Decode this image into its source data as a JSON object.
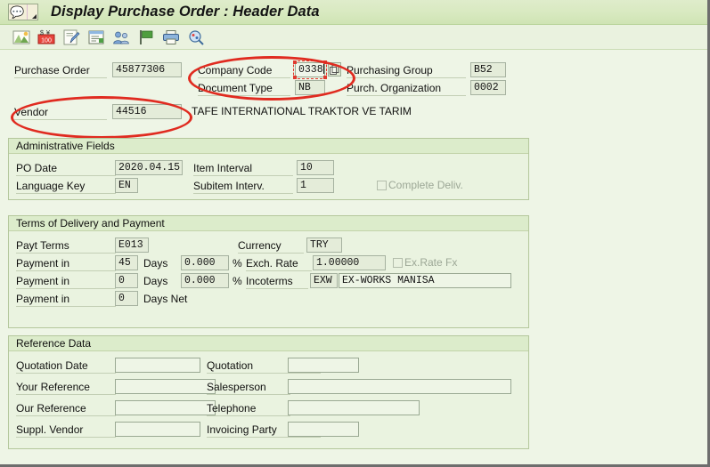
{
  "window": {
    "title": "Display Purchase Order : Header Data",
    "system_menu_icon": "sap-menu-icon"
  },
  "toolbar": {
    "buttons": [
      {
        "name": "overview-icon",
        "label": "Overview"
      },
      {
        "name": "currency-icon",
        "label": "Currency"
      },
      {
        "name": "edit-icon",
        "label": "Display/Change"
      },
      {
        "name": "header-details-icon",
        "label": "Header Details"
      },
      {
        "name": "partners-icon",
        "label": "Partners"
      },
      {
        "name": "flag-icon",
        "label": "Flag"
      },
      {
        "name": "print-icon",
        "label": "Print Preview"
      },
      {
        "name": "find-icon",
        "label": "Find"
      }
    ]
  },
  "header": {
    "purchase_order_label": "Purchase Order",
    "purchase_order_value": "45877306",
    "vendor_label": "Vendor",
    "vendor_value": "44516",
    "vendor_name": "TAFE INTERNATIONAL TRAKTOR VE TARIM",
    "company_code_label": "Company Code",
    "company_code_value": "0338",
    "document_type_label": "Document Type",
    "document_type_value": "NB",
    "purchasing_group_label": "Purchasing Group",
    "purchasing_group_value": "B52",
    "purch_organization_label": "Purch. Organization",
    "purch_organization_value": "0002"
  },
  "administrative": {
    "title": "Administrative Fields",
    "po_date_label": "PO Date",
    "po_date_value": "2020.04.15",
    "language_key_label": "Language Key",
    "language_key_value": "EN",
    "item_interval_label": "Item Interval",
    "item_interval_value": "10",
    "subitem_interval_label": "Subitem Interv.",
    "subitem_interval_value": "1",
    "complete_deliv_label": "Complete Deliv.",
    "complete_deliv_checked": false
  },
  "terms": {
    "title": "Terms of Delivery and Payment",
    "payt_terms_label": "Payt Terms",
    "payt_terms_value": "E013",
    "payment_in_label": "Payment in",
    "days_label": "Days",
    "days_net_label": "Days Net",
    "percent_symbol": "%",
    "payment_rows": [
      {
        "days": "45",
        "percent": "0.000"
      },
      {
        "days": "0",
        "percent": "0.000"
      },
      {
        "days": "0",
        "percent": ""
      }
    ],
    "currency_label": "Currency",
    "currency_value": "TRY",
    "exch_rate_label": "Exch. Rate",
    "exch_rate_value": "1.00000",
    "ex_rate_fx_label": "Ex.Rate Fx",
    "ex_rate_fx_checked": false,
    "incoterms_label": "Incoterms",
    "incoterms_code": "EXW",
    "incoterms_text": "EX-WORKS MANISA"
  },
  "reference": {
    "title": "Reference Data",
    "quotation_date_label": "Quotation Date",
    "quotation_date_value": "",
    "your_reference_label": "Your Reference",
    "your_reference_value": "",
    "our_reference_label": "Our Reference",
    "our_reference_value": "",
    "suppl_vendor_label": "Suppl. Vendor",
    "suppl_vendor_value": "",
    "quotation_label": "Quotation",
    "quotation_value": "",
    "salesperson_label": "Salesperson",
    "salesperson_value": "",
    "telephone_label": "Telephone",
    "telephone_value": "",
    "invoicing_party_label": "Invoicing Party",
    "invoicing_party_value": ""
  },
  "annotations": {
    "color": "#e02b20",
    "highlight_company_code": "company-code-highlight",
    "highlight_vendor": "vendor-highlight"
  },
  "colors": {
    "window_background": "#eef5e6",
    "titlebar": "#d8e9c0",
    "group_header": "#dceccb",
    "field_border": "#9aa993",
    "annotation_red": "#e02b20"
  }
}
